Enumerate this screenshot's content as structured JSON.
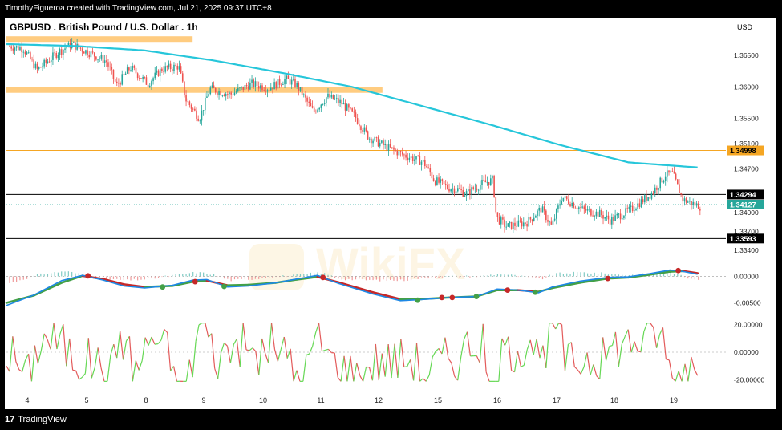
{
  "header": {
    "caption": "TimothyFigueroa created with TradingView.com, Jul 21, 2025 09:37 UTC+8"
  },
  "footer": {
    "brand": "TradingView",
    "logo_glyph": "17"
  },
  "watermark": {
    "text": "WikiFX"
  },
  "colors": {
    "up": "#26a69a",
    "down": "#ef5350",
    "ma": "#26c6da",
    "zone": "#ffcc80",
    "orange_line": "#f5a623",
    "macd": "#1e88e5",
    "signal_up": "#43a047",
    "signal_down": "#c62828"
  },
  "chart_data": [
    {
      "type": "candlestick",
      "title": "GBPUSD . British Pound / U.S. Dollar . 1h",
      "currency": "USD",
      "ylim": [
        1.3325,
        1.3682
      ],
      "y_ticks": [
        "1.36500",
        "1.36000",
        "1.35500",
        "1.35100",
        "1.34700",
        "1.34000",
        "1.33700",
        "1.33400"
      ],
      "x_ticks": [
        "4",
        "5",
        "8",
        "9",
        "10",
        "11",
        "12",
        "15",
        "16",
        "17",
        "18",
        "19"
      ],
      "grid": false,
      "close_anchors": [
        [
          0,
          1.3665
        ],
        [
          0.02,
          1.3661
        ],
        [
          0.04,
          1.3627
        ],
        [
          0.07,
          1.3655
        ],
        [
          0.09,
          1.3668
        ],
        [
          0.11,
          1.3657
        ],
        [
          0.14,
          1.3641
        ],
        [
          0.155,
          1.3602
        ],
        [
          0.175,
          1.3631
        ],
        [
          0.2,
          1.3605
        ],
        [
          0.22,
          1.3628
        ],
        [
          0.245,
          1.3633
        ],
        [
          0.255,
          1.358
        ],
        [
          0.275,
          1.355
        ],
        [
          0.29,
          1.3597
        ],
        [
          0.32,
          1.3588
        ],
        [
          0.35,
          1.3605
        ],
        [
          0.375,
          1.3598
        ],
        [
          0.4,
          1.3612
        ],
        [
          0.415,
          1.3604
        ],
        [
          0.44,
          1.356
        ],
        [
          0.46,
          1.3585
        ],
        [
          0.48,
          1.3575
        ],
        [
          0.5,
          1.3553
        ],
        [
          0.52,
          1.352
        ],
        [
          0.545,
          1.3505
        ],
        [
          0.57,
          1.3492
        ],
        [
          0.6,
          1.348
        ],
        [
          0.615,
          1.3452
        ],
        [
          0.635,
          1.344
        ],
        [
          0.65,
          1.3437
        ],
        [
          0.66,
          1.343
        ],
        [
          0.685,
          1.3447
        ],
        [
          0.7,
          1.3452
        ],
        [
          0.705,
          1.3392
        ],
        [
          0.72,
          1.3378
        ],
        [
          0.75,
          1.3385
        ],
        [
          0.77,
          1.3407
        ],
        [
          0.785,
          1.3378
        ],
        [
          0.8,
          1.3425
        ],
        [
          0.83,
          1.3405
        ],
        [
          0.855,
          1.3398
        ],
        [
          0.87,
          1.3388
        ],
        [
          0.9,
          1.3405
        ],
        [
          0.93,
          1.3431
        ],
        [
          0.95,
          1.346
        ],
        [
          0.96,
          1.3462
        ],
        [
          0.975,
          1.3421
        ],
        [
          1.0,
          1.341
        ]
      ],
      "ma_anchors": [
        [
          0,
          1.3668
        ],
        [
          0.1,
          1.3665
        ],
        [
          0.2,
          1.3658
        ],
        [
          0.3,
          1.3642
        ],
        [
          0.4,
          1.3622
        ],
        [
          0.5,
          1.36
        ],
        [
          0.6,
          1.357
        ],
        [
          0.7,
          1.354
        ],
        [
          0.8,
          1.3508
        ],
        [
          0.9,
          1.348
        ],
        [
          1.0,
          1.3472
        ]
      ],
      "levels": [
        {
          "kind": "zone",
          "price": 1.3676,
          "x_end": 0.26
        },
        {
          "kind": "zone",
          "price": 1.3595,
          "x_end": 0.525
        },
        {
          "kind": "line",
          "price": 1.3499,
          "label": "1.34998",
          "color": "#f5a623"
        },
        {
          "kind": "line",
          "price": 1.3429,
          "label": "1.34294",
          "color": "#000000"
        },
        {
          "kind": "dotted",
          "price": 1.3413,
          "label": "1.34127",
          "color": "#26a69a"
        },
        {
          "kind": "line",
          "price": 1.3359,
          "label": "1.33593",
          "color": "#000000"
        }
      ]
    },
    {
      "type": "macd",
      "ylim": [
        -0.0072,
        0.0028
      ],
      "y_ticks": [
        "0.00000",
        "-0.00500"
      ],
      "macd_anchors": [
        [
          0,
          -0.0055
        ],
        [
          0.04,
          -0.0035
        ],
        [
          0.08,
          -0.0008
        ],
        [
          0.11,
          0.0002
        ],
        [
          0.14,
          -0.0007
        ],
        [
          0.17,
          -0.0018
        ],
        [
          0.2,
          -0.0022
        ],
        [
          0.24,
          -0.0017
        ],
        [
          0.27,
          -0.0007
        ],
        [
          0.29,
          -0.0006
        ],
        [
          0.32,
          -0.002
        ],
        [
          0.35,
          -0.0018
        ],
        [
          0.39,
          -0.0012
        ],
        [
          0.42,
          -0.0005
        ],
        [
          0.45,
          0.0002
        ],
        [
          0.48,
          -0.0013
        ],
        [
          0.53,
          -0.0033
        ],
        [
          0.57,
          -0.0046
        ],
        [
          0.6,
          -0.0044
        ],
        [
          0.64,
          -0.004
        ],
        [
          0.68,
          -0.0038
        ],
        [
          0.71,
          -0.0024
        ],
        [
          0.74,
          -0.0026
        ],
        [
          0.77,
          -0.0031
        ],
        [
          0.79,
          -0.002
        ],
        [
          0.83,
          -0.0009
        ],
        [
          0.87,
          -0.0002
        ],
        [
          0.9,
          -0.0001
        ],
        [
          0.93,
          0.0005
        ],
        [
          0.96,
          0.0012
        ],
        [
          0.98,
          0.0009
        ],
        [
          1.0,
          0.0004
        ]
      ],
      "signal_anchors": [
        [
          0,
          -0.005
        ],
        [
          0.04,
          -0.0036
        ],
        [
          0.08,
          -0.0012
        ],
        [
          0.11,
          0.0001
        ],
        [
          0.14,
          -0.0005
        ],
        [
          0.17,
          -0.0015
        ],
        [
          0.2,
          -0.002
        ],
        [
          0.24,
          -0.0018
        ],
        [
          0.27,
          -0.001
        ],
        [
          0.29,
          -0.0008
        ],
        [
          0.32,
          -0.0017
        ],
        [
          0.35,
          -0.0016
        ],
        [
          0.39,
          -0.0012
        ],
        [
          0.42,
          -0.0006
        ],
        [
          0.45,
          -0.0001
        ],
        [
          0.48,
          -0.0011
        ],
        [
          0.53,
          -0.003
        ],
        [
          0.57,
          -0.0043
        ],
        [
          0.6,
          -0.0043
        ],
        [
          0.64,
          -0.004
        ],
        [
          0.68,
          -0.0038
        ],
        [
          0.71,
          -0.0026
        ],
        [
          0.74,
          -0.0026
        ],
        [
          0.77,
          -0.0029
        ],
        [
          0.79,
          -0.0022
        ],
        [
          0.83,
          -0.0012
        ],
        [
          0.87,
          -0.0004
        ],
        [
          0.9,
          -0.0002
        ],
        [
          0.93,
          0.0003
        ],
        [
          0.96,
          0.0009
        ],
        [
          0.98,
          0.001
        ],
        [
          1.0,
          0.0006
        ]
      ],
      "crosses": [
        {
          "x": 0.118,
          "y": 0.0001,
          "type": "bearish"
        },
        {
          "x": 0.226,
          "y": -0.002,
          "type": "bullish"
        },
        {
          "x": 0.273,
          "y": -0.001,
          "type": "bearish"
        },
        {
          "x": 0.315,
          "y": -0.0019,
          "type": "bullish"
        },
        {
          "x": 0.458,
          "y": -0.0002,
          "type": "bearish"
        },
        {
          "x": 0.595,
          "y": -0.0045,
          "type": "bullish"
        },
        {
          "x": 0.63,
          "y": -0.004,
          "type": "bearish"
        },
        {
          "x": 0.645,
          "y": -0.004,
          "type": "bearish"
        },
        {
          "x": 0.68,
          "y": -0.0038,
          "type": "bullish"
        },
        {
          "x": 0.725,
          "y": -0.0026,
          "type": "bearish"
        },
        {
          "x": 0.765,
          "y": -0.003,
          "type": "bullish"
        },
        {
          "x": 0.87,
          "y": -0.0004,
          "type": "bearish"
        },
        {
          "x": 0.972,
          "y": 0.0011,
          "type": "bearish"
        }
      ]
    },
    {
      "type": "oscillator",
      "ylim": [
        -26,
        26
      ],
      "y_ticks": [
        "20.00000",
        "0.00000",
        "-20.00000"
      ],
      "reference_levels": [
        0,
        20,
        -20
      ]
    }
  ]
}
